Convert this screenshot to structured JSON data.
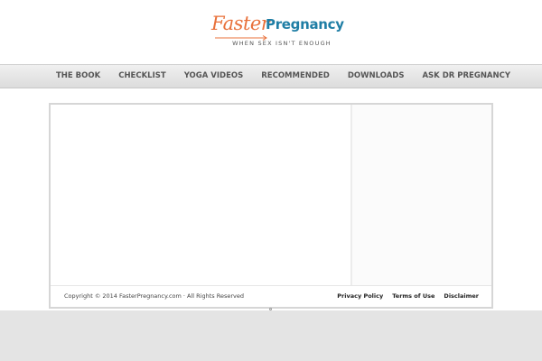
{
  "header": {
    "logo_word_1": "Faster",
    "logo_word_2": "Pregnancy",
    "tagline": "WHEN SEX ISN'T ENOUGH"
  },
  "nav": {
    "items": [
      {
        "label": "THE BOOK"
      },
      {
        "label": "CHECKLIST"
      },
      {
        "label": "YOGA VIDEOS"
      },
      {
        "label": "RECOMMENDED"
      },
      {
        "label": "DOWNLOADS"
      },
      {
        "label": "ASK DR PREGNANCY"
      }
    ]
  },
  "footer": {
    "copyright": "Copyright © 2014 FasterPregnancy.com · All Rights Reserved",
    "links": [
      {
        "label": "Privacy Policy"
      },
      {
        "label": "Terms of Use"
      },
      {
        "label": "Disclaimer"
      }
    ]
  },
  "colors": {
    "logo_orange": "#e8703a",
    "logo_blue": "#1f7ea5",
    "nav_text": "#555555"
  }
}
